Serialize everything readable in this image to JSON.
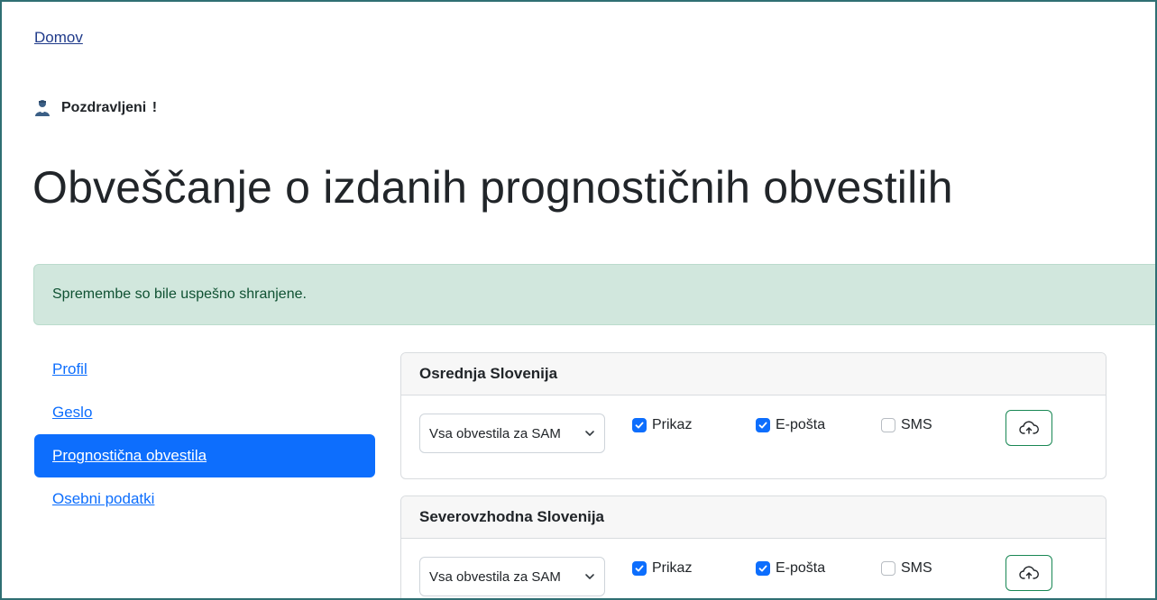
{
  "nav": {
    "home_label": "Domov"
  },
  "greeting": {
    "text": "Pozdravljeni",
    "suffix": "!"
  },
  "page": {
    "title": "Obveščanje o izdanih prognostičnih obvestilih"
  },
  "alert": {
    "message": "Spremembe so bile uspešno shranjene."
  },
  "sidebar": {
    "items": [
      {
        "label": "Profil",
        "active": false
      },
      {
        "label": "Geslo",
        "active": false
      },
      {
        "label": "Prognostična obvestila",
        "active": true
      },
      {
        "label": "Osebni podatki",
        "active": false
      }
    ]
  },
  "regions": [
    {
      "title": "Osrednja Slovenija",
      "select_value": "Vsa obvestila za SAM",
      "options": {
        "prikaz": "Prikaz",
        "eposta": "E-pošta",
        "sms": "SMS"
      },
      "checked": {
        "prikaz": true,
        "eposta": true,
        "sms": false
      }
    },
    {
      "title": "Severovzhodna Slovenija",
      "select_value": "Vsa obvestila za SAM",
      "options": {
        "prikaz": "Prikaz",
        "eposta": "E-pošta",
        "sms": "SMS"
      },
      "checked": {
        "prikaz": true,
        "eposta": true,
        "sms": false
      }
    }
  ],
  "icons": {
    "user": "user-icon",
    "chevron": "chevron-down-icon",
    "checkbox_checked": "checkmark-icon",
    "upload": "cloud-upload-icon"
  },
  "colors": {
    "primary": "#0d6efd",
    "success_bg": "#d1e7dd",
    "success_text": "#0f5132",
    "success_border": "#198754",
    "frame": "#2f6f73"
  }
}
